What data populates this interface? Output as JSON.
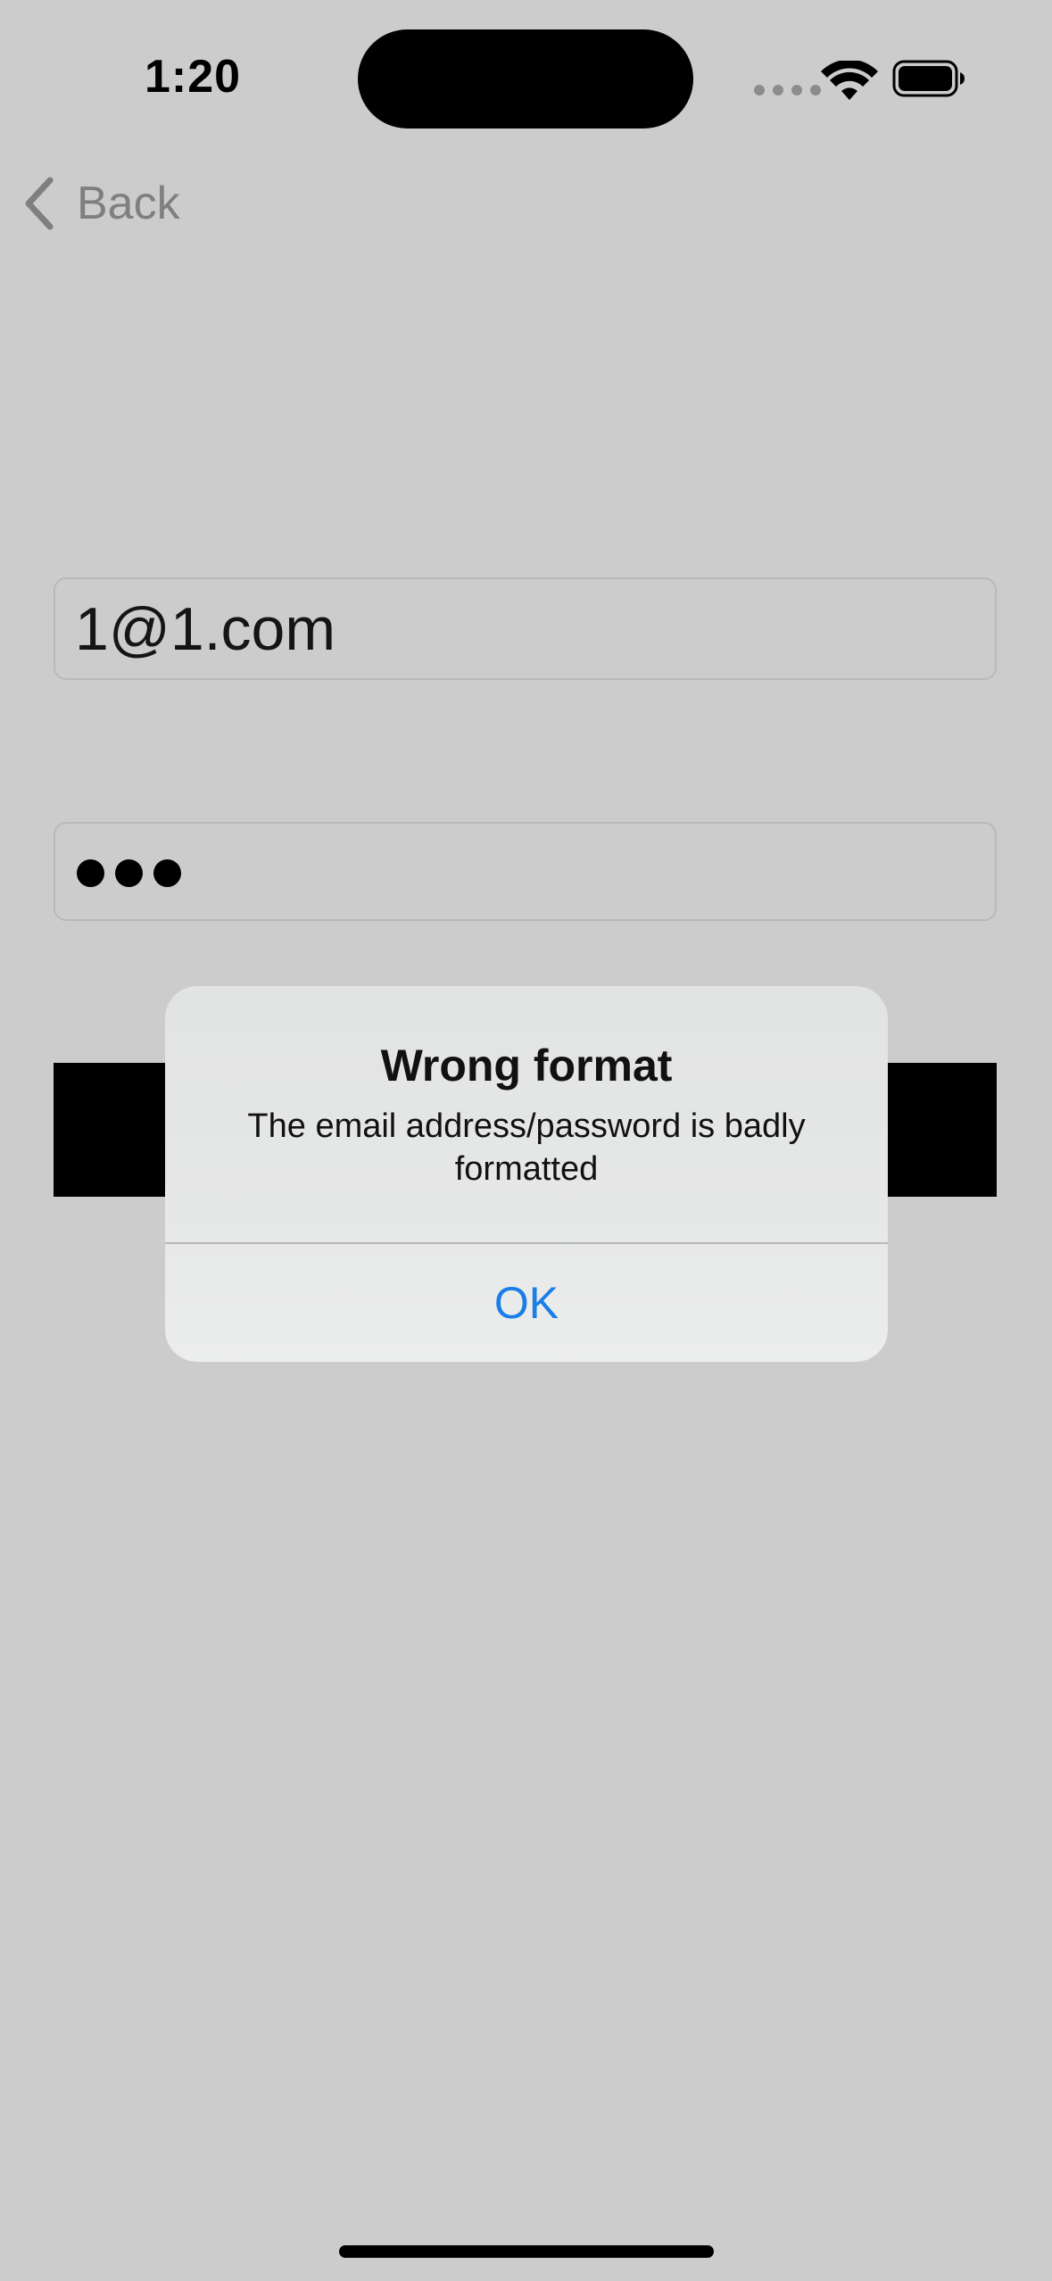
{
  "status_bar": {
    "time": "1:20"
  },
  "nav": {
    "back_label": "Back"
  },
  "form": {
    "email_value": "1@1.com",
    "password_mask_count": 3
  },
  "alert": {
    "title": "Wrong format",
    "message": "The email address/password is badly formatted",
    "ok_label": "OK"
  },
  "icons": [
    "wifi-icon",
    "battery-icon",
    "chevron-left-icon"
  ],
  "colors": {
    "background": "#cccccc",
    "alert_button": "#1a7ee8",
    "back_label": "#7f7f7f"
  }
}
